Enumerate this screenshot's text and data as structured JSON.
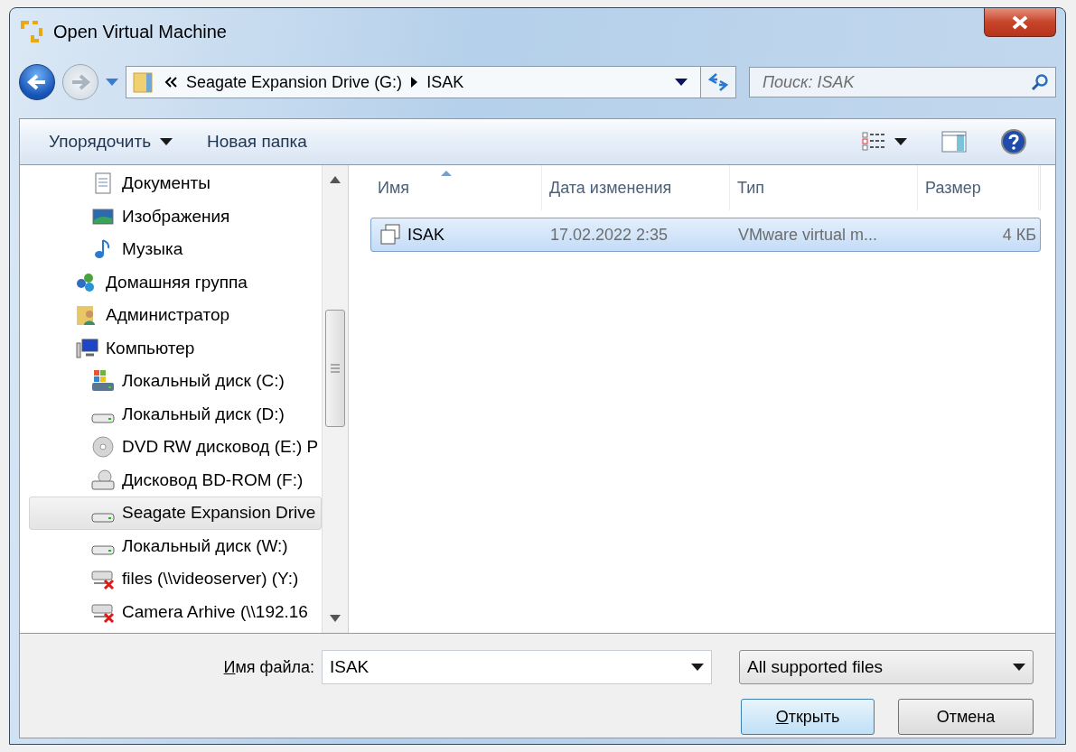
{
  "window": {
    "title": "Open Virtual Machine"
  },
  "address": {
    "crumbs": [
      "Seagate Expansion Drive (G:)",
      "ISAK"
    ]
  },
  "search": {
    "placeholder": "Поиск: ISAK"
  },
  "toolbar": {
    "organize": "Упорядочить",
    "new_folder": "Новая папка"
  },
  "tree": [
    {
      "children": [
        {
          "label": "Документы",
          "kind": "document",
          "selected": false
        },
        {
          "label": "Изображения",
          "kind": "image",
          "selected": false
        },
        {
          "label": "Музыка",
          "kind": "music",
          "selected": false
        }
      ]
    },
    {
      "label": "Домашняя группа",
      "kind": "homegroup",
      "selected": false
    },
    {
      "label": "Администратор",
      "kind": "user",
      "selected": false
    },
    {
      "label": "Компьютер",
      "kind": "computer",
      "selected": false,
      "children": [
        {
          "label": "Локальный диск (C:)",
          "kind": "system-drive",
          "selected": false
        },
        {
          "label": "Локальный диск (D:)",
          "kind": "drive",
          "selected": false
        },
        {
          "label": "DVD RW дисковод (E:) P",
          "kind": "dvd",
          "selected": false
        },
        {
          "label": "Дисковод BD-ROM (F:)",
          "kind": "bdrom",
          "selected": false
        },
        {
          "label": "Seagate Expansion Drive",
          "kind": "drive",
          "selected": true
        },
        {
          "label": "Локальный диск (W:)",
          "kind": "drive",
          "selected": false
        },
        {
          "label": "files (\\\\videoserver) (Y:)",
          "kind": "offline-drive",
          "selected": false
        },
        {
          "label": "Camera Arhive (\\\\192.16",
          "kind": "offline-drive",
          "selected": false
        }
      ]
    }
  ],
  "table": {
    "columns": [
      "Имя",
      "Дата изменения",
      "Тип",
      "Размер"
    ],
    "rows": [
      {
        "cells": [
          "ISAK",
          "17.02.2022 2:35",
          "VMware virtual m...",
          "4 КБ"
        ],
        "selected": true
      }
    ]
  },
  "filename": {
    "label": "Имя файла:",
    "value": "ISAK"
  },
  "filter": {
    "value": "All supported files"
  },
  "buttons": [
    "Открыть",
    "Отмена"
  ]
}
